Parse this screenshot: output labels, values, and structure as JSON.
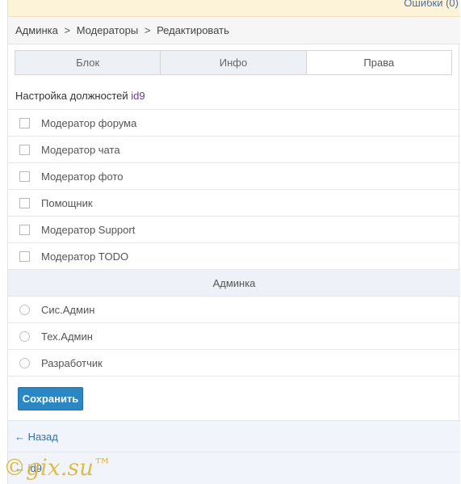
{
  "topbar": {
    "errors_link": "Ошибки (0)"
  },
  "breadcrumb": {
    "items": [
      "Админка",
      "Модераторы",
      "Редактировать"
    ],
    "separator": ">"
  },
  "tabs": [
    {
      "label": "Блок",
      "active": false
    },
    {
      "label": "Инфо",
      "active": false
    },
    {
      "label": "Права",
      "active": true
    }
  ],
  "section": {
    "title": "Настройка должностей",
    "user_id": "id9"
  },
  "permissions": [
    {
      "label": "Модератор форума",
      "checked": false
    },
    {
      "label": "Модератор чата",
      "checked": false
    },
    {
      "label": "Модератор фото",
      "checked": false
    },
    {
      "label": "Помощник",
      "checked": false
    },
    {
      "label": "Модератор Support",
      "checked": false
    },
    {
      "label": "Модератор TODO",
      "checked": false
    }
  ],
  "admin_group": {
    "header": "Админка",
    "options": [
      {
        "label": "Сис.Админ",
        "selected": false
      },
      {
        "label": "Тех.Админ",
        "selected": false
      },
      {
        "label": "Разработчик",
        "selected": false
      }
    ]
  },
  "actions": {
    "save_label": "Сохранить"
  },
  "nav": {
    "back_label": "← Назад",
    "user_link": "← id9"
  },
  "watermark": {
    "text": "©gix.su",
    "tm": "™"
  },
  "colors": {
    "accent": "#2a87c3",
    "topbar_bg": "#fdf3d8",
    "group_bg": "#eef1f7",
    "link": "#3a6e9e",
    "user_id": "#6b3a8a",
    "watermark": "#d9b52a"
  }
}
